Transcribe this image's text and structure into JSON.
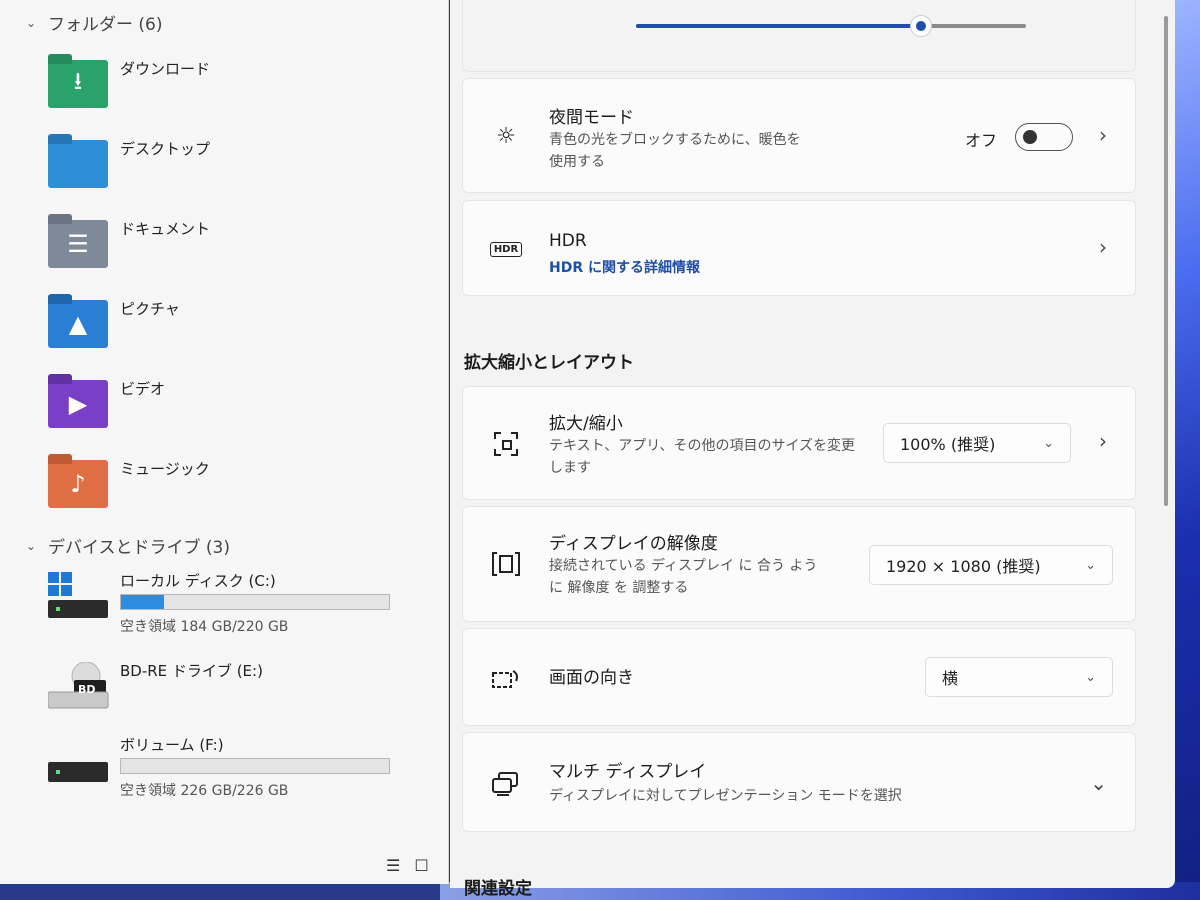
{
  "explorer": {
    "folders_group": {
      "label": "フォルダー (6)"
    },
    "folders": [
      {
        "label": "ダウンロード",
        "icon": "download-folder-icon",
        "color": "#2aa36b",
        "glyph": "⭳"
      },
      {
        "label": "デスクトップ",
        "icon": "desktop-folder-icon",
        "color": "#2f8fd6",
        "glyph": ""
      },
      {
        "label": "ドキュメント",
        "icon": "documents-folder-icon",
        "color": "#7f8a99",
        "glyph": "☰"
      },
      {
        "label": "ピクチャ",
        "icon": "pictures-folder-icon",
        "color": "#2a7fd4",
        "glyph": "▲"
      },
      {
        "label": "ビデオ",
        "icon": "videos-folder-icon",
        "color": "#7a3fc7",
        "glyph": "▶"
      },
      {
        "label": "ミュージック",
        "icon": "music-folder-icon",
        "color": "#e06f45",
        "glyph": "♪"
      }
    ],
    "drives_group": {
      "label": "デバイスとドライブ (3)"
    },
    "drives": [
      {
        "name": "ローカル ディスク (C:)",
        "free": "空き領域 184 GB/220 GB",
        "used_fraction": 0.16,
        "icon": "windows-drive-icon"
      },
      {
        "name": "BD-RE ドライブ (E:)",
        "free": "",
        "used_fraction": null,
        "icon": "bd-drive-icon",
        "badge": "BD"
      },
      {
        "name": "ボリューム (F:)",
        "free": "空き領域 226 GB/226 GB",
        "used_fraction": 0.0,
        "icon": "volume-drive-icon"
      }
    ]
  },
  "settings": {
    "brightness_level": 0.73,
    "night_mode": {
      "title": "夜間モード",
      "desc_line1": "青色の光をブロックするために、暖色を",
      "desc_line2": "使用する",
      "state": "オフ"
    },
    "hdr": {
      "title": "HDR",
      "badge": "HDR",
      "link": "HDR に関する詳細情報"
    },
    "scale_section_heading": "拡大縮小とレイアウト",
    "scale": {
      "title": "拡大/縮小",
      "desc_line1": "テキスト、アプリ、その他の項目のサイズを変更",
      "desc_line2": "します",
      "value": "100% (推奨)"
    },
    "resolution": {
      "title": "ディスプレイの解像度",
      "desc_line1": "接続されている ディスプレイ に 合う よう",
      "desc_line2": "に 解像度 を 調整する",
      "value": "1920 × 1080 (推奨)"
    },
    "orientation": {
      "title": "画面の向き",
      "value": "横"
    },
    "multi_display": {
      "title": "マルチ ディスプレイ",
      "desc": "ディスプレイに対してプレゼンテーション モードを選択"
    },
    "related_heading": "関連設定"
  },
  "colors": {
    "accent": "#1f4fa8",
    "drive_fill": "#2b8ee0"
  }
}
